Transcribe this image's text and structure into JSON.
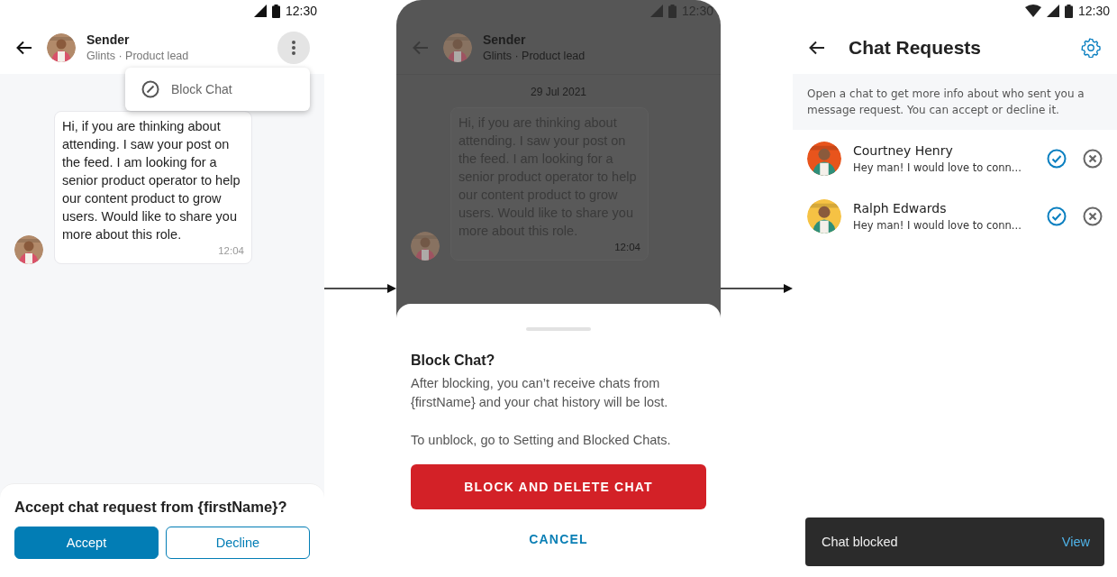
{
  "chat_screen": {
    "status_time": "12:30",
    "sender": {
      "name": "Sender",
      "subtitle": "Glints · Product lead"
    },
    "menu": {
      "items": [
        {
          "label": "Block Chat"
        }
      ]
    },
    "message": {
      "text": "Hi, if you are thinking about attending. I saw your post on the feed. I am looking for a senior product operator to help our content product to grow users. Would like to share you more about this role.",
      "time": "12:04"
    },
    "accept_panel": {
      "title": "Accept chat request from {firstName}?",
      "buttons": [
        {
          "label": "Accept",
          "kind": "primary"
        },
        {
          "label": "Decline",
          "kind": "outline"
        }
      ]
    }
  },
  "block_screen": {
    "status_time": "12:30",
    "sender": {
      "name": "Sender",
      "subtitle": "Glints · Product lead"
    },
    "date": "29 Jul 2021",
    "message": {
      "text": "Hi, if you are thinking about attending. I saw your post on the feed. I am looking for a senior product operator to help our content product to grow users. Would like to share you more about this role.",
      "time": "12:04"
    },
    "sheet": {
      "title": "Block Chat?",
      "body": "After blocking, you can’t receive chats from {firstName} and your chat history will be lost.",
      "note": "To unblock, go to Setting and Blocked Chats.",
      "buttons": [
        {
          "label": "BLOCK AND DELETE CHAT",
          "kind": "danger"
        },
        {
          "label": "CANCEL",
          "kind": "text"
        }
      ]
    }
  },
  "requests_screen": {
    "status_time": "12:30",
    "title": "Chat Requests",
    "info": "Open a chat to get more info about who sent you a message request. You can accept or decline it.",
    "requests": [
      {
        "name": "Courtney Henry",
        "preview": "Hey man! I would love to conn..."
      },
      {
        "name": "Ralph Edwards",
        "preview": "Hey man! I would love to conn..."
      }
    ],
    "toast": {
      "message": "Chat blocked",
      "action": "View"
    }
  }
}
